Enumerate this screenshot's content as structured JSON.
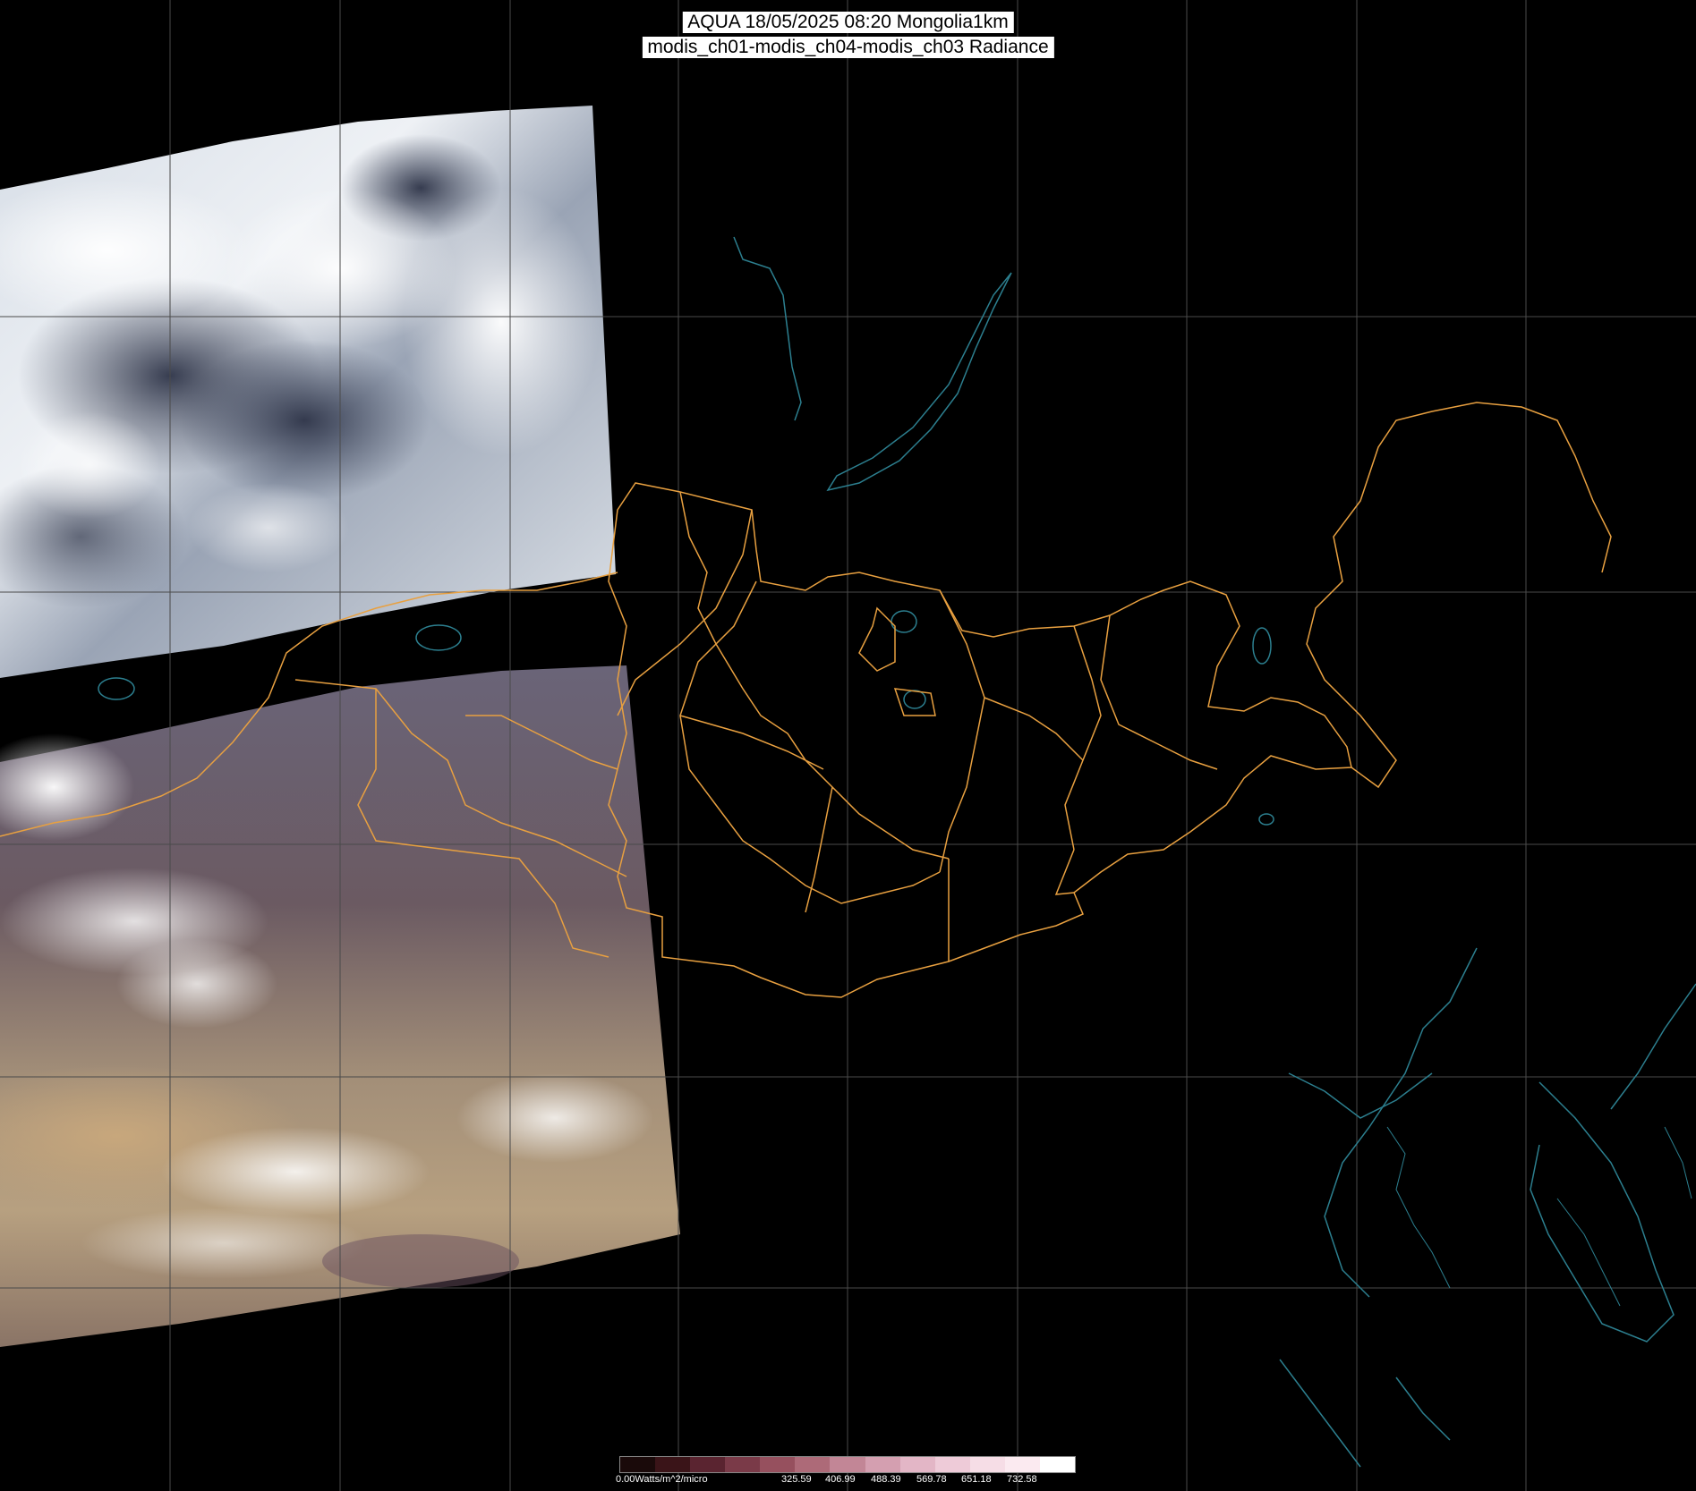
{
  "header": {
    "line1": "AQUA 18/05/2025 08:20 Mongolia1km",
    "line2": "modis_ch01-modis_ch04-modis_ch03 Radiance"
  },
  "colors": {
    "background": "#000000",
    "graticule": "#4a4a4a",
    "borders": "#e8a040",
    "coastlines": "#2c7f8f",
    "clouds": "#e8ecf2",
    "desert": "#b09070",
    "steppe": "#5d5670"
  },
  "colorbar": {
    "unit_label": "0.00Watts/m^2/micro",
    "ticks": [
      "325.59",
      "406.99",
      "488.39",
      "569.78",
      "651.18",
      "732.58"
    ],
    "colors": [
      "#1a0a0a",
      "#3a1418",
      "#5a2430",
      "#7a3a48",
      "#96505e",
      "#ad6a78",
      "#c28696",
      "#d49fb0",
      "#e3b6c6",
      "#eecbd8",
      "#f6dde6",
      "#fbeaf0",
      "#ffffff"
    ]
  },
  "imagery": {
    "description_icons": [
      "satellite-swath-north",
      "satellite-swath-south"
    ]
  }
}
